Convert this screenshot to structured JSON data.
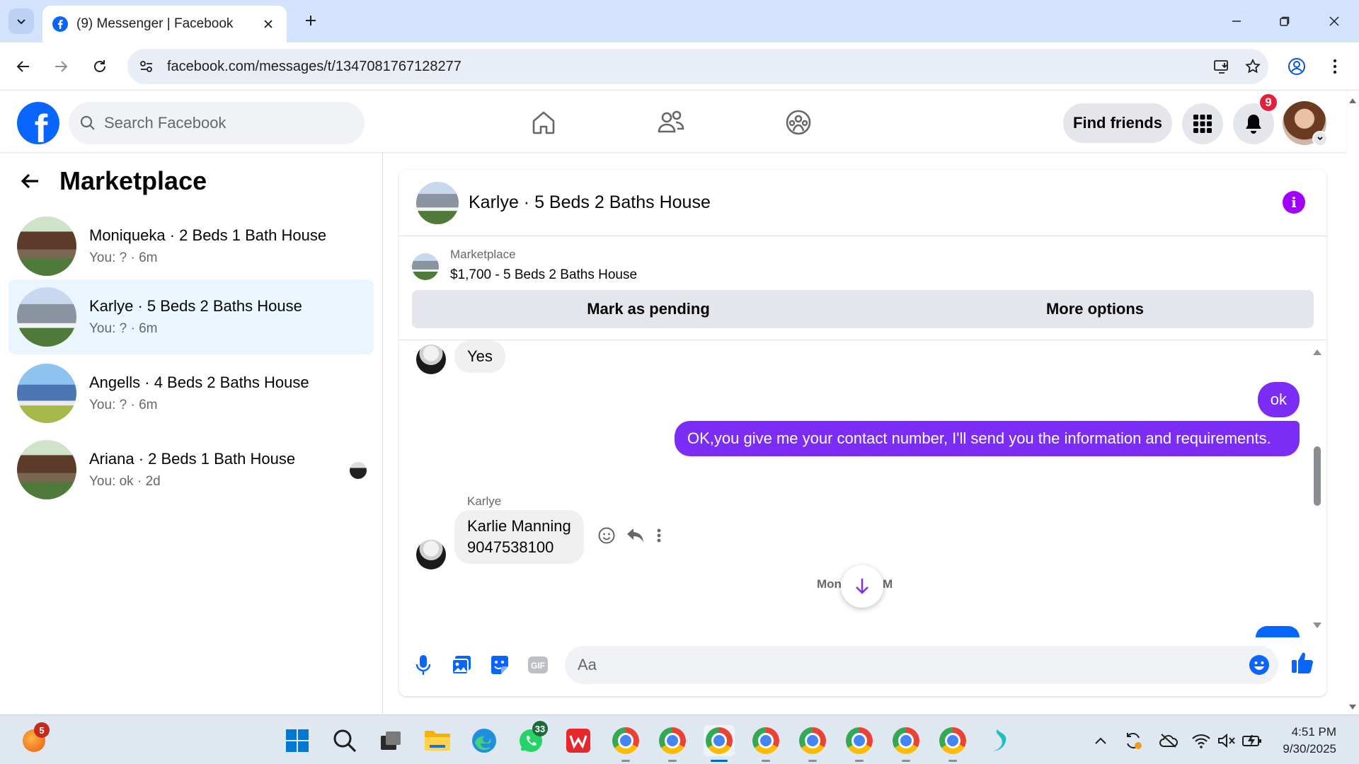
{
  "browser": {
    "tab_title": "(9) Messenger | Facebook",
    "url": "facebook.com/messages/t/1347081767128277"
  },
  "header": {
    "search_placeholder": "Search Facebook",
    "find_friends": "Find friends",
    "notification_count": "9"
  },
  "sidebar": {
    "title": "Marketplace",
    "conversations": [
      {
        "name": "Moniqueka · 2 Beds 1 Bath House",
        "preview": "You: ? · 6m",
        "active": false
      },
      {
        "name": "Karlye · 5 Beds 2 Baths House",
        "preview": "You: ? · 6m",
        "active": true
      },
      {
        "name": "Angells · 4 Beds 2 Baths House",
        "preview": "You: ? · 6m",
        "active": false
      },
      {
        "name": "Ariana · 2 Beds 1 Bath House",
        "preview": "You: ok · 2d",
        "active": false
      }
    ]
  },
  "chat": {
    "title": "Karlye · 5 Beds 2 Baths House",
    "listing_label": "Marketplace",
    "listing_price": "$1,700 - 5 Beds 2 Baths House",
    "mark_pending": "Mark as pending",
    "more_options": "More options",
    "messages": {
      "in_yes": "Yes",
      "out_ok": "ok",
      "out_long": "OK,you give me your contact number, I'll send you the information and requirements.",
      "sender": "Karlye",
      "in_contact_line1": "Karlie Manning",
      "in_contact_line2": "9047538100"
    },
    "date_left": "Mon",
    "date_right": "M",
    "composer_placeholder": "Aa"
  },
  "taskbar": {
    "app_badge": "5",
    "whatsapp_badge": "33",
    "time": "4:51 PM",
    "date": "9/30/2025"
  },
  "colors": {
    "fb_blue": "#0866ff",
    "outgoing_bubble": "#7b2cf5",
    "active_row": "#ebf5ff"
  }
}
